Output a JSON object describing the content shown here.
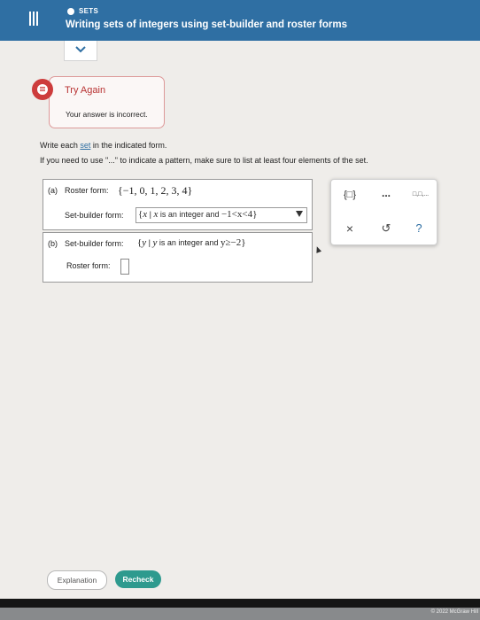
{
  "header": {
    "topic": "SETS",
    "title": "Writing sets of integers using set-builder and roster forms"
  },
  "feedback": {
    "title": "Try Again",
    "message": "Your answer is incorrect."
  },
  "instructions": {
    "line1_before": "Write each ",
    "line1_link": "set",
    "line1_after": " in the indicated form.",
    "line2": "If you need to use \"...\" to indicate a pattern, make sure to list at least four elements of the set."
  },
  "part_a": {
    "label": "(a)",
    "given_label": "Roster form:",
    "given_value": "{−1, 0, 1, 2, 3, 4}",
    "answer_label": "Set-builder form:",
    "answer_open": "{",
    "answer_var": "x",
    "answer_text": " is an integer and ",
    "answer_cond": "−1<x<4",
    "answer_close": "}"
  },
  "part_b": {
    "label": "(b)",
    "given_label": "Set-builder form:",
    "given_open": "{",
    "given_var": "y",
    "given_text": " is an integer and ",
    "given_cond": "y≥−2",
    "given_close": "}",
    "answer_label": "Roster form:"
  },
  "tools": {
    "set_braces_icon": "{□}",
    "ellipsis": "...",
    "roster_icon": "□,□,...",
    "clear": "×",
    "undo": "↺",
    "help": "?"
  },
  "buttons": {
    "explanation": "Explanation",
    "recheck": "Recheck"
  },
  "footer": {
    "copyright": "© 2022 McGraw Hill"
  },
  "colors": {
    "header": "#2f6fa3",
    "error": "#cd3c3c",
    "recheck": "#2e9a8e"
  }
}
